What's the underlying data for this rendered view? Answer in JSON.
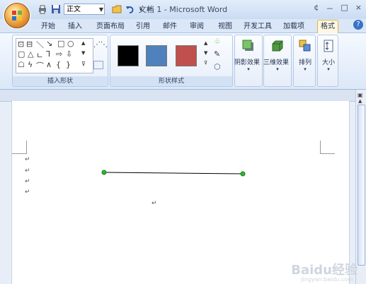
{
  "window": {
    "title": "文档 1 - Microsoft Word",
    "controls": [
      "¢",
      "－",
      "□",
      "×"
    ]
  },
  "qat": {
    "style_value": "正文"
  },
  "tabs": [
    "开始",
    "插入",
    "页面布局",
    "引用",
    "邮件",
    "审阅",
    "视图",
    "开发工具",
    "加载项",
    "格式"
  ],
  "active_tab": "格式",
  "ribbon": {
    "group_shapes_label": "插入形状",
    "group_styles_label": "形状样式",
    "shadow_label": "阴影效果",
    "threed_label": "三维效果",
    "arrange_label": "排列",
    "size_label": "大小",
    "swatch_colors": [
      "#000000",
      "#4f81bd",
      "#c0504d"
    ],
    "accent_color": "#e3b24b"
  },
  "document": {
    "para_mark": "↵",
    "line_color": "#000000",
    "handle_color": "#2db92d"
  },
  "watermark": {
    "brand": "Baidu经验",
    "url": "jingyan.baidu.com"
  }
}
